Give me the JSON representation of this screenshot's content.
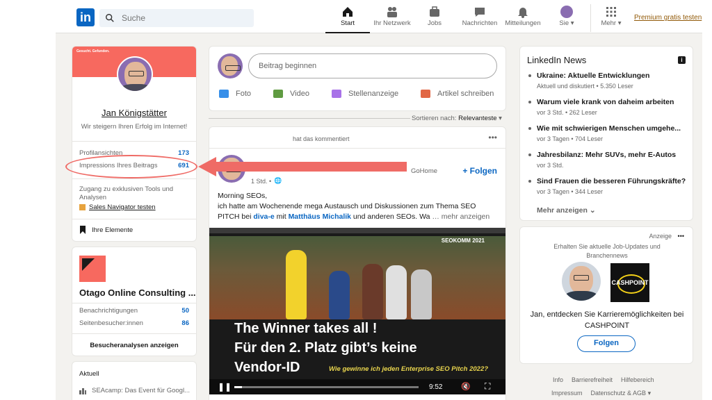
{
  "nav": {
    "search_placeholder": "Suche",
    "items": [
      {
        "label": "Start",
        "icon": "home-icon"
      },
      {
        "label": "Ihr Netzwerk",
        "icon": "network-icon"
      },
      {
        "label": "Jobs",
        "icon": "briefcase-icon"
      },
      {
        "label": "Nachrichten",
        "icon": "chat-icon"
      },
      {
        "label": "Mitteilungen",
        "icon": "bell-icon"
      },
      {
        "label": "Sie",
        "icon": "avatar"
      },
      {
        "label": "Mehr",
        "icon": "grid-icon"
      }
    ],
    "premium": "Premium gratis testen"
  },
  "profile": {
    "banner_text": "Gesucht. Gefunden.",
    "name": "Jan Königstätter",
    "tagline": "Wir steigern Ihren Erfolg im Internet!",
    "stats": [
      {
        "label": "Profilansichten",
        "value": "173"
      },
      {
        "label": "Impressions Ihres Beitrags",
        "value": "691"
      }
    ],
    "premium_text": "Zugang zu exklusiven Tools und Analysen",
    "sales_link": "Sales Navigator testen",
    "elements": "Ihre Elemente"
  },
  "company": {
    "name": "Otago Online Consulting ...",
    "stats": [
      {
        "label": "Benachrichtigungen",
        "value": "50"
      },
      {
        "label": "Seitenbesucher:innen",
        "value": "86"
      }
    ],
    "analytics": "Besucheranalysen anzeigen"
  },
  "recent": {
    "title": "Aktuell",
    "item": "SEAcamp: Das Event für Googl..."
  },
  "composer": {
    "placeholder": "Beitrag beginnen",
    "actions": [
      {
        "label": "Foto",
        "color": "#378fe9"
      },
      {
        "label": "Video",
        "color": "#5f9b41"
      },
      {
        "label": "Stellenanzeige",
        "color": "#a872e8"
      },
      {
        "label": "Artikel schreiben",
        "color": "#e16745"
      }
    ]
  },
  "sort": {
    "label": "Sortieren nach:",
    "value": "Relevanteste"
  },
  "post": {
    "header": "hat das kommentiert",
    "menu": "•••",
    "meta": "1 Std. •",
    "author_suffix": "GoHome",
    "follow": "+ Folgen",
    "text_1": "Morning SEOs,",
    "text_2": "ich hatte am Wochenende mega Austausch und Diskussionen zum Thema SEO",
    "text_3a": "PITCH bei ",
    "link_1": "diva-e",
    "text_3b": " mit ",
    "link_2": "Matthäus Michalik",
    "text_3c": " und anderen SEOs. Wa",
    "more": "… mehr anzeigen"
  },
  "video": {
    "badge": "SEOKOMM 2021",
    "line1": "The Winner takes all !",
    "line2": "Für den 2. Platz gibt’s keine",
    "line3": "Vendor-ID",
    "subline": "Wie gewinne ich jeden Enterprise SEO Pitch 2022?",
    "time": "9:52",
    "progress": 0.04
  },
  "news": {
    "title": "LinkedIn News",
    "items": [
      {
        "headline": "Ukraine: Aktuelle Entwicklungen",
        "sub": "Aktuell und diskutiert • 5.350 Leser"
      },
      {
        "headline": "Warum viele krank von daheim arbeiten",
        "sub": "vor 3 Std. • 262 Leser"
      },
      {
        "headline": "Wie mit schwierigen Menschen umgehe...",
        "sub": "vor 3 Tagen • 704 Leser"
      },
      {
        "headline": "Jahresbilanz: Mehr SUVs, mehr E-Autos",
        "sub": "vor 3 Std."
      },
      {
        "headline": "Sind Frauen die besseren Führungskräfte?",
        "sub": "vor 3 Tagen • 344 Leser"
      }
    ],
    "more": "Mehr anzeigen"
  },
  "ad": {
    "label": "Anzeige",
    "text": "Erhalten Sie aktuelle Job-Updates und Branchennews",
    "brand": "CASHPOINT",
    "desc": "Jan, entdecken Sie Karrieremöglichkeiten bei CASHPOINT",
    "button": "Folgen"
  },
  "footer": {
    "row1": [
      "Info",
      "Barrierefreiheit",
      "Hilfebereich"
    ],
    "row2": [
      "Impressum",
      "Datenschutz & AGB"
    ]
  },
  "colors": {
    "brand": "#0a66c2",
    "annotation": "#ef6b66",
    "banner": "#f7695f"
  }
}
